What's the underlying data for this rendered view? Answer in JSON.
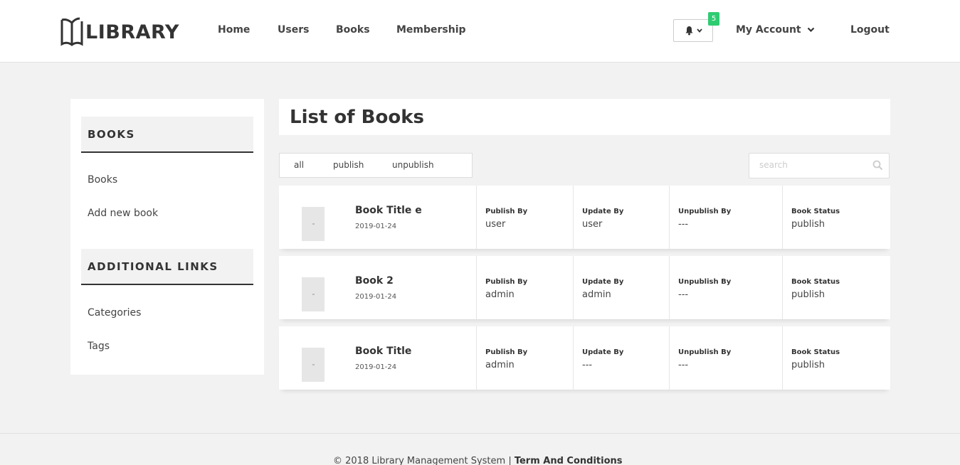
{
  "header": {
    "logo_text": "LIBRARY",
    "nav": [
      "Home",
      "Users",
      "Books",
      "Membership"
    ],
    "notification_count": "5",
    "account_label": "My Account",
    "logout_label": "Logout"
  },
  "sidebar": {
    "section1_title": "BOOKS",
    "section1_links": [
      "Books",
      "Add new book"
    ],
    "section2_title": "ADDITIONAL LINKS",
    "section2_links": [
      "Categories",
      "Tags"
    ]
  },
  "main": {
    "title": "List of Books",
    "filters": [
      "all",
      "publish",
      "unpublish"
    ],
    "search_placeholder": "search",
    "column_labels": {
      "publish_by": "Publish By",
      "update_by": "Update By",
      "unpublish_by": "Unpublish By",
      "status": "Book Status"
    },
    "books": [
      {
        "title": "Book Title e",
        "date": "2019-01-24",
        "publish_by": "user",
        "update_by": "user",
        "unpublish_by": "---",
        "status": "publish"
      },
      {
        "title": "Book 2",
        "date": "2019-01-24",
        "publish_by": "admin",
        "update_by": "admin",
        "unpublish_by": "---",
        "status": "publish"
      },
      {
        "title": "Book Title",
        "date": "2019-01-24",
        "publish_by": "admin",
        "update_by": "---",
        "unpublish_by": "---",
        "status": "publish"
      }
    ]
  },
  "footer": {
    "copyright": "© 2018 Library Management System  |",
    "terms_link": "Term And Conditions"
  },
  "colors": {
    "badge": "#2ecc71",
    "background": "#f2f2f2"
  }
}
